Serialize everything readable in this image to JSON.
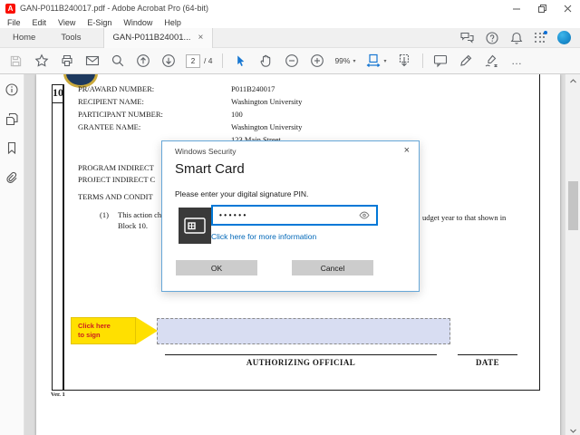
{
  "window": {
    "title": "GAN-P011B240017.pdf - Adobe Acrobat Pro (64-bit)",
    "app_icon_letter": "A"
  },
  "menu": {
    "items": [
      "File",
      "Edit",
      "View",
      "E-Sign",
      "Window",
      "Help"
    ]
  },
  "tabs": {
    "home": "Home",
    "tools": "Tools",
    "document": "GAN-P011B24001...",
    "close_glyph": "×"
  },
  "toolbar": {
    "page_current": "2",
    "page_total": "/ 4",
    "zoom_level": "99%",
    "caret_glyph": "▾",
    "overflow_glyph": "…"
  },
  "document": {
    "block_number": "10",
    "fields": [
      {
        "label": "PR/AWARD NUMBER:",
        "value": "P011B240017"
      },
      {
        "label": "RECIPIENT NAME:",
        "value": "Washington University"
      },
      {
        "label": "PARTICIPANT NUMBER:",
        "value": "100"
      },
      {
        "label": "GRANTEE NAME:",
        "value": "Washington University"
      }
    ],
    "address_line": "123 Main Street",
    "program_line": "PROGRAM INDIRECT",
    "project_line": "PROJECT INDIRECT C",
    "terms_line": "TERMS AND CONDIT",
    "clause_number": "(1)",
    "clause_left": "This action ch",
    "clause_right": "udget year to that shown in",
    "clause_line2": "Block 10.",
    "callout": {
      "line1": "Click here",
      "line2": "to sign"
    },
    "authorizing_official": "AUTHORIZING OFFICIAL",
    "date_label": "DATE",
    "version": "Ver. 1"
  },
  "dialog": {
    "titlebar": "Windows Security",
    "close_glyph": "×",
    "title": "Smart Card",
    "message": "Please enter your digital signature PIN.",
    "pin_value": "••••••",
    "link": "Click here for more information",
    "ok_label": "OK",
    "cancel_label": "Cancel"
  },
  "colors": {
    "accent_blue": "#0078d7",
    "link_blue": "#0067b8",
    "dialog_border": "#66a7d8",
    "acrobat_red": "#fa0f00",
    "callout_yellow": "#ffe000",
    "callout_text_red": "#cc1f1f",
    "signature_field_lavender": "#d8ddf2",
    "avatar_blue": "#1c8fd0",
    "selection_blue": "#1877d2"
  }
}
